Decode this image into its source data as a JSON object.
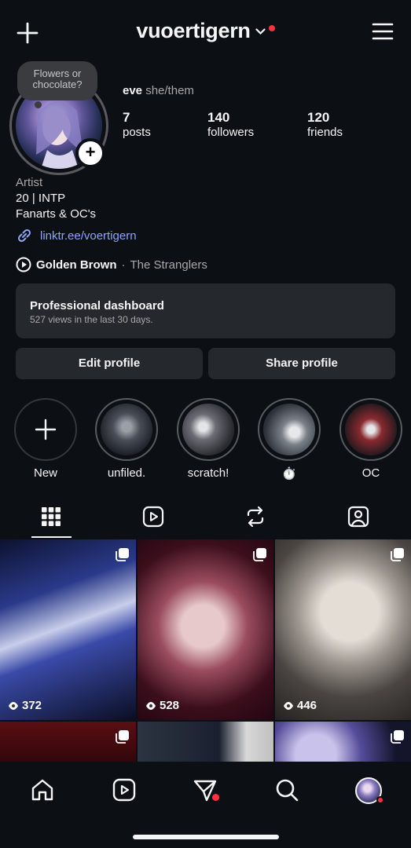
{
  "header": {
    "username": "vuoertigern"
  },
  "profile": {
    "note": "Flowers or chocolate?",
    "full_name": "eve",
    "pronouns": "she/them",
    "posts_count": "7",
    "posts_label": "posts",
    "followers_count": "140",
    "followers_label": "followers",
    "friends_count": "120",
    "friends_label": "friends",
    "category": "Artist",
    "bio_line1": "20 | INTP",
    "bio_line2": "Fanarts & OC's",
    "link": "linktr.ee/voertigern",
    "song": "Golden Brown",
    "song_separator": "·",
    "artist": "The Stranglers"
  },
  "dashboard": {
    "title": "Professional dashboard",
    "subtitle": "527 views in the last 30 days."
  },
  "buttons": {
    "edit": "Edit profile",
    "share": "Share profile"
  },
  "highlights": [
    {
      "label": "New"
    },
    {
      "label": "unfiled."
    },
    {
      "label": "scratch!"
    },
    {
      "label": "⏱️"
    },
    {
      "label": "OC"
    }
  ],
  "posts": [
    {
      "views": "372"
    },
    {
      "views": "528"
    },
    {
      "views": "446"
    }
  ],
  "colors": {
    "background": "#0c1014",
    "link": "#8ea5f4",
    "notification": "#ff3040",
    "card": "#25292e"
  },
  "icons": [
    "plus-icon",
    "chevron-down-icon",
    "hamburger-menu-icon",
    "link-icon",
    "play-circle-icon",
    "grid-icon",
    "reels-icon",
    "repost-icon",
    "tagged-icon",
    "eye-icon",
    "multi-post-icon",
    "home-icon",
    "send-icon",
    "search-icon"
  ]
}
